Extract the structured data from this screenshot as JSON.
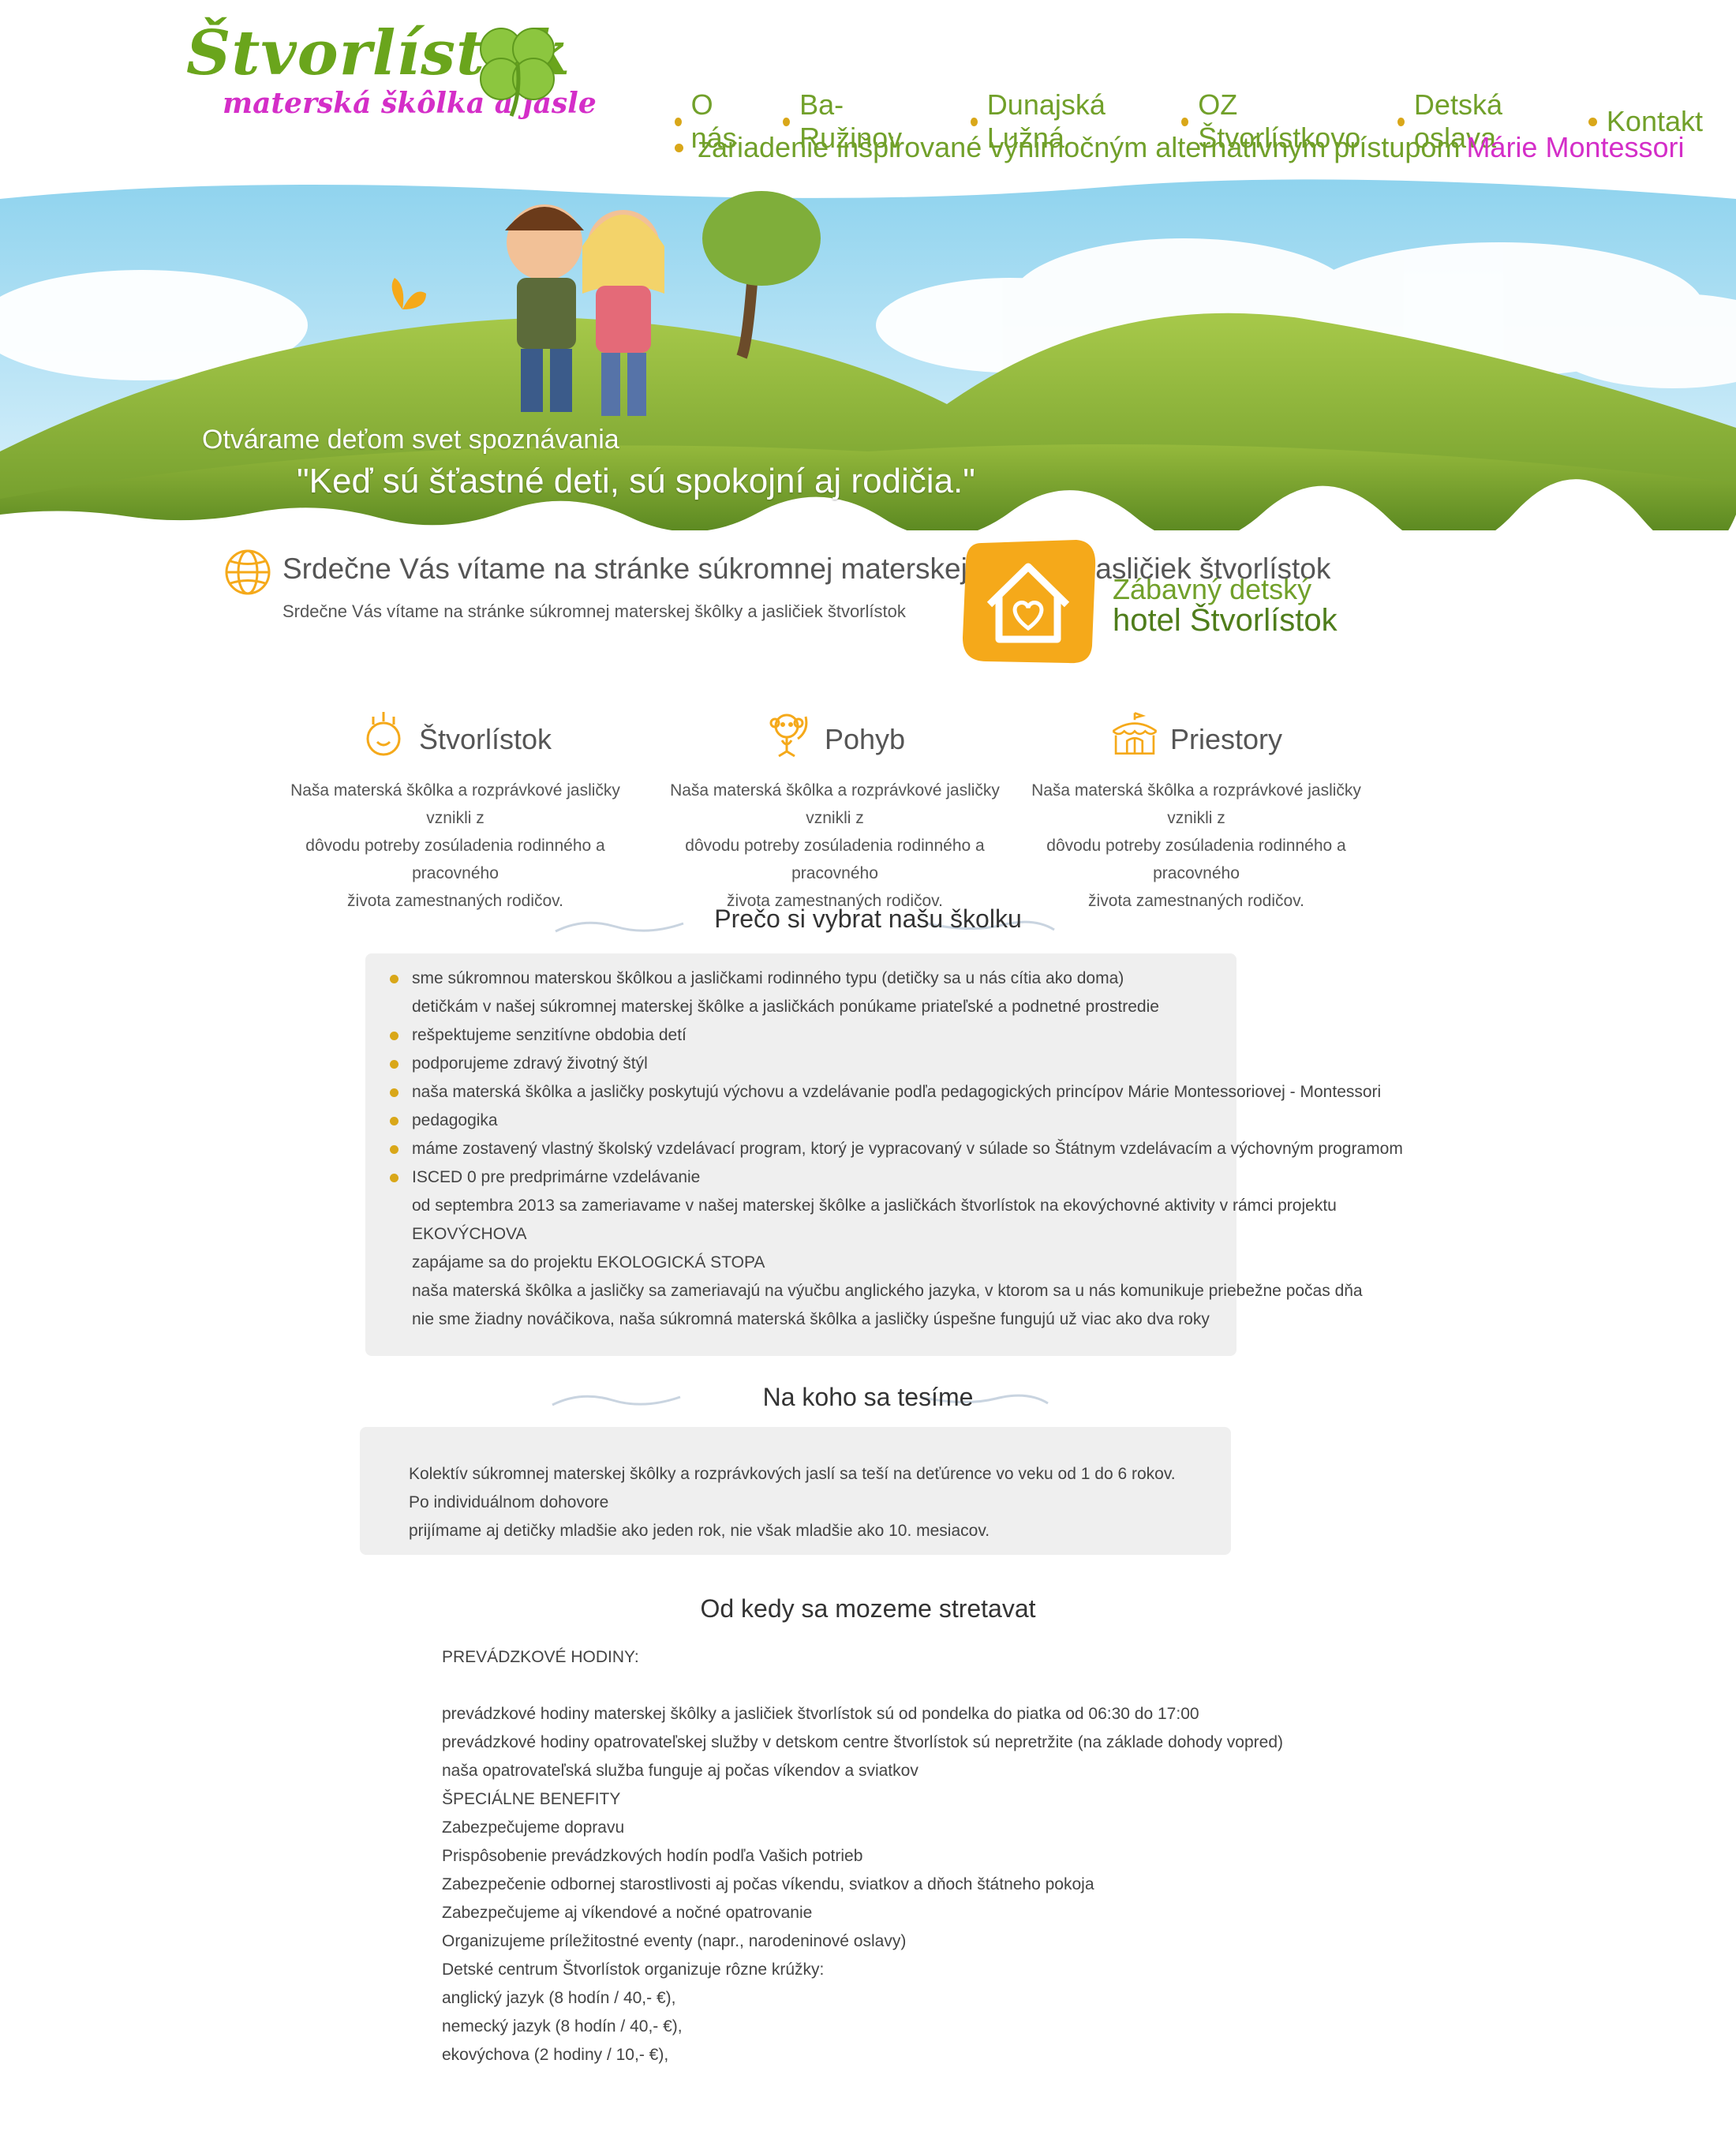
{
  "header": {
    "logo_title": "Štvorlístok",
    "logo_subtitle": "materská škôlka a jasle",
    "nav": [
      "O nás",
      "Ba- Ružinov",
      "Dunajská Lužná",
      "OZ Štvorlístkovo",
      "Detská oslava",
      "Kontakt"
    ],
    "nav_line2": "zariadenie inšpirované výnimočným alternatívnym prístupom",
    "nav_line2_highlight": "Márie Montessori"
  },
  "hero": {
    "tagline": "Otvárame deťom svet spoznávania",
    "quote": "\"Keď sú šťastné deti, sú spokojní aj rodičia.\""
  },
  "welcome": {
    "title": "Srdečne Vás vítame na stránke súkromnej materskej škôlky a jasličiek štvorlístok",
    "subtitle": "Srdečne Vás vítame na stránke súkromnej materskej škôlky a jasličiek štvorlístok"
  },
  "hotel": {
    "line1": "Zábavný detský",
    "line2": "hotel Štvorlístok"
  },
  "features": [
    {
      "title": "Štvorlístok",
      "l1": "Naša materská škôlka a rozprávkové jasličky vznikli z",
      "l2": "dôvodu potreby zosúladenia rodinného a pracovného",
      "l3": "života zamestnaných rodičov."
    },
    {
      "title": "Pohyb",
      "l1": "Naša materská škôlka a rozprávkové jasličky vznikli z",
      "l2": "dôvodu potreby zosúladenia rodinného a pracovného",
      "l3": "života zamestnaných rodičov."
    },
    {
      "title": "Priestory",
      "l1": "Naša materská škôlka a rozprávkové jasličky vznikli z",
      "l2": "dôvodu potreby zosúladenia rodinného a pracovného",
      "l3": "života zamestnaných rodičov."
    }
  ],
  "why": {
    "heading": "Prečo si vybrat našu školku",
    "items": [
      "sme súkromnou materskou škôlkou a jasličkami rodinného typu (detičky sa u nás cítia ako doma)",
      "detičkám v našej súkromnej materskej škôlke a jasličkách ponúkame priateľské a podnetné prostredie",
      "rešpektujeme senzitívne obdobia detí",
      "podporujeme zdravý životný štýl",
      "naša materská škôlka a jasličky poskytujú výchovu a vzdelávanie podľa pedagogických princípov Márie Montessoriovej - Montessori",
      "pedagogika",
      "máme zostavený vlastný školský vzdelávací program, ktorý je vypracovaný v súlade so Štátnym vzdelávacím a výchovným programom",
      "ISCED 0 pre predprimárne vzdelávanie",
      "od septembra 2013 sa zameriavame v našej materskej škôlke a jasličkách štvorlístok na ekovýchovné aktivity v rámci projektu",
      "EKOVÝCHOVA",
      "zapájame sa do projektu EKOLOGICKÁ STOPA",
      "naša materská škôlka a jasličky sa zameriavajú na výučbu anglického jazyka, v ktorom sa u nás komunikuje priebežne počas dňa",
      "nie sme žiadny nováčikova, naša súkromná materská škôlka a jasličky úspešne fungujú už viac ako dva roky"
    ]
  },
  "who": {
    "heading": "Na koho sa tesíme",
    "line1": "Kolektív súkromnej materskej škôlky a rozprávkových jaslí sa teší na deťúrence vo veku od 1 do 6 rokov. Po individuálnom dohovore",
    "line2": "prijímame aj detičky mladšie ako jeden rok, nie však mladšie ako 10. mesiacov."
  },
  "when": {
    "heading": "Od kedy sa mozeme stretavat",
    "lines": [
      "PREVÁDZKOVÉ HODINY:",
      "",
      "prevádzkové hodiny materskej škôlky a jasličiek štvorlístok sú od pondelka do piatka od 06:30 do 17:00",
      "prevádzkové hodiny opatrovateľskej služby v detskom centre štvorlístok sú nepretržite (na základe dohody vopred)",
      "naša opatrovateľská služba funguje aj počas víkendov a sviatkov",
      "ŠPECIÁLNE BENEFITY",
      "Zabezpečujeme dopravu",
      "Prispôsobenie prevádzkových hodín podľa Vašich potrieb",
      "Zabezpečenie odbornej starostlivosti aj počas víkendu, sviatkov a dňoch štátneho pokoja",
      "Zabezpečujeme aj víkendové a nočné opatrovanie",
      "Organizujeme príležitostné eventy (napr., narodeninové oslavy)",
      "Detské centrum Štvorlístok organizuje rôzne krúžky:",
      "anglický jazyk (8 hodín / 40,- €),",
      "nemecký jazyk (8 hodín / 40,- €),",
      "ekovýchova (2 hodiny / 10,- €),"
    ]
  },
  "colors": {
    "green": "#71a02a",
    "pink": "#d42ec8",
    "gold": "#d9a719",
    "orange": "#f5a91a",
    "box": "#efefef"
  }
}
